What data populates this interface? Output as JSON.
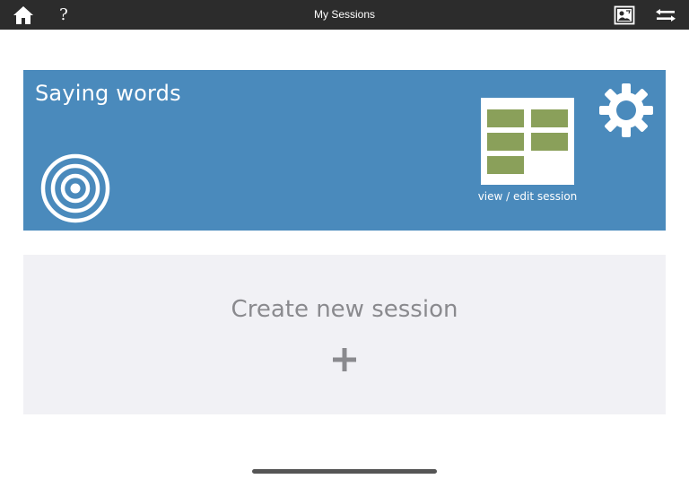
{
  "header": {
    "title": "My Sessions",
    "help_label": "?"
  },
  "session": {
    "title": "Saying words",
    "edit_label": "view / edit session"
  },
  "create": {
    "label": "Create new session"
  },
  "colors": {
    "topbar": "#2c2c2c",
    "session_card": "#4a8abc",
    "board_cell": "#8aa05a",
    "create_card": "#f1f1f5",
    "create_text": "#8a8a8e"
  },
  "icons": {
    "home": "home-icon",
    "help": "help-icon",
    "picture": "picture-icon",
    "swap": "swap-icon",
    "target": "target-icon",
    "board": "board-icon",
    "gear": "gear-icon",
    "plus": "plus-icon"
  }
}
